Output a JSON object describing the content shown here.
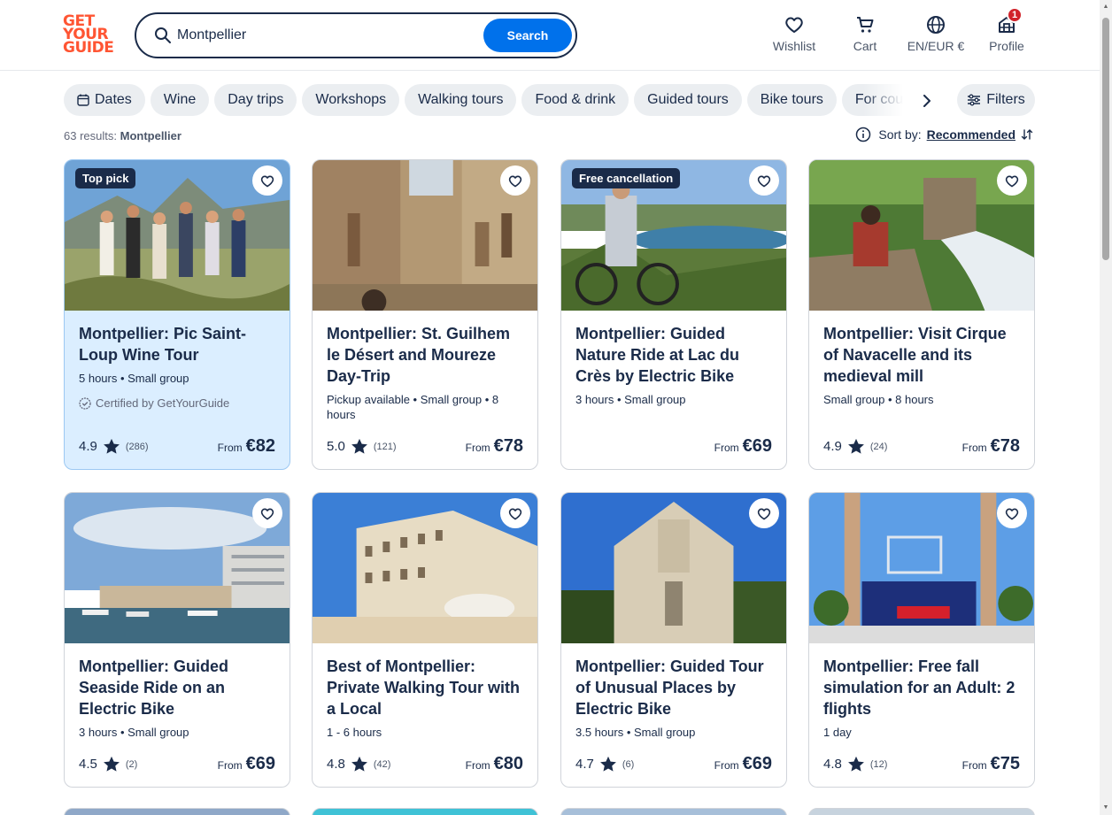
{
  "header": {
    "logo_lines": [
      "GET",
      "YOUR",
      "GUIDE"
    ],
    "search_value": "Montpellier",
    "search_button": "Search",
    "nav": [
      {
        "label": "Wishlist",
        "icon": "heart-icon"
      },
      {
        "label": "Cart",
        "icon": "cart-icon"
      },
      {
        "label": "EN/EUR €",
        "icon": "globe-icon"
      },
      {
        "label": "Profile",
        "icon": "profile-icon",
        "badge": "1"
      }
    ]
  },
  "chips": [
    "Dates",
    "Wine",
    "Day trips",
    "Workshops",
    "Walking tours",
    "Food & drink",
    "Guided tours",
    "Bike tours",
    "For couples"
  ],
  "filters_label": "Filters",
  "results": {
    "count_text": "63 results:",
    "location": "Montpellier"
  },
  "sort": {
    "label": "Sort by:",
    "value": "Recommended"
  },
  "cards": [
    {
      "title": "Montpellier: Pic Saint-Loup Wine Tour",
      "meta": "5 hours • Small group",
      "certified": "Certified by GetYourGuide",
      "tag": "Top pick",
      "rating": "4.9",
      "reviews": "(286)",
      "from": "From",
      "price": "€82"
    },
    {
      "title": "Montpellier: St. Guilhem le Désert and Moureze Day-Trip",
      "meta": "Pickup available • Small group • 8 hours",
      "rating": "5.0",
      "reviews": "(121)",
      "from": "From",
      "price": "€78"
    },
    {
      "title": "Montpellier: Guided Nature Ride at Lac du Crès by Electric Bike",
      "meta": "3 hours • Small group",
      "tag": "Free cancellation",
      "rating": "",
      "reviews": "",
      "from": "From",
      "price": "€69"
    },
    {
      "title": "Montpellier: Visit Cirque of Navacelle and its medieval mill",
      "meta": "Small group • 8 hours",
      "rating": "4.9",
      "reviews": "(24)",
      "from": "From",
      "price": "€78"
    },
    {
      "title": "Montpellier: Guided Seaside Ride on an Electric Bike",
      "meta": "3 hours • Small group",
      "rating": "4.5",
      "reviews": "(2)",
      "from": "From",
      "price": "€69"
    },
    {
      "title": "Best of Montpellier: Private Walking Tour with a Local",
      "meta": "1 - 6 hours",
      "rating": "4.8",
      "reviews": "(42)",
      "from": "From",
      "price": "€80"
    },
    {
      "title": "Montpellier: Guided Tour of Unusual Places by Electric Bike",
      "meta": "3.5 hours • Small group",
      "rating": "4.7",
      "reviews": "(6)",
      "from": "From",
      "price": "€69"
    },
    {
      "title": "Montpellier: Free fall simulation for an Adult: 2 flights",
      "meta": "1 day",
      "rating": "4.8",
      "reviews": "(12)",
      "from": "From",
      "price": "€75"
    }
  ],
  "colors": {
    "brand": "#ff5533",
    "primary_button": "#0071eb",
    "text": "#1a2b49",
    "badge": "#d1232a",
    "highlight_card": "#dbeeff"
  }
}
